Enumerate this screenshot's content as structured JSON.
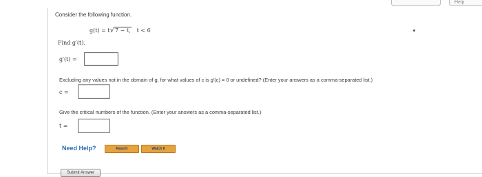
{
  "top_tabs": {
    "right_label": "Help"
  },
  "question": {
    "intro": "Consider the following function.",
    "function": {
      "lhs": "g(t) = t",
      "radicand": "7 − t,",
      "condition": "t < 6"
    },
    "part1": {
      "prompt": "Find g′(t).",
      "answer_label": "g′(t) =",
      "answer_value": ""
    },
    "part2": {
      "prompt": "Excluding any values not in the domain of g, for what values of c is g′(c) = 0 or undefined? (Enter your answers as a comma-separated list.)",
      "answer_label": "c =",
      "answer_value": ""
    },
    "part3": {
      "prompt": "Give the critical numbers of the function. (Enter your answers as a comma-separated list.)",
      "answer_label": "t =",
      "answer_value": ""
    }
  },
  "help": {
    "label": "Need Help?",
    "read_label": "Read It",
    "watch_label": "Watch It"
  },
  "submit_label": "Submit Answer"
}
